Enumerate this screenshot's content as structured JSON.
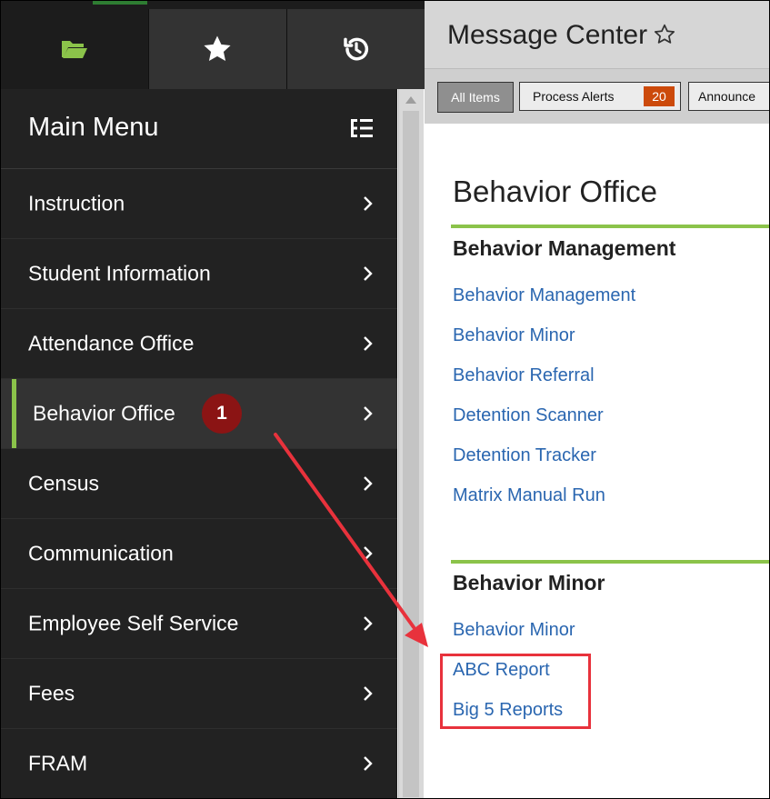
{
  "sidebar": {
    "title": "Main Menu",
    "badge": "1",
    "items": [
      {
        "label": "Instruction"
      },
      {
        "label": "Student Information"
      },
      {
        "label": "Attendance Office"
      },
      {
        "label": "Behavior Office"
      },
      {
        "label": "Census"
      },
      {
        "label": "Communication"
      },
      {
        "label": "Employee Self Service"
      },
      {
        "label": "Fees"
      },
      {
        "label": "FRAM"
      }
    ],
    "icons": [
      "folder-open-icon",
      "star-icon",
      "history-icon",
      "tree-list-icon",
      "chevron-right-icon"
    ]
  },
  "header": {
    "title": "Message Center",
    "tabs": {
      "all": "All Items",
      "alerts": "Process Alerts",
      "alerts_count": "20",
      "announcements": "Announce"
    }
  },
  "main": {
    "section_title": "Behavior Office",
    "group1": {
      "title": "Behavior Management",
      "links": [
        "Behavior Management",
        "Behavior Minor",
        "Behavior Referral",
        "Detention Scanner",
        "Detention Tracker",
        "Matrix Manual Run"
      ]
    },
    "group2": {
      "title": "Behavior Minor",
      "links": [
        "Behavior Minor",
        "ABC Report",
        "Big 5 Reports"
      ]
    }
  },
  "colors": {
    "sidebar_bg": "#222222",
    "accent_green": "#8bc34a",
    "badge_red": "#8b1414",
    "alert_orange": "#cc4a0b",
    "link_blue": "#2a66b0",
    "highlight_red": "#e8323c"
  }
}
